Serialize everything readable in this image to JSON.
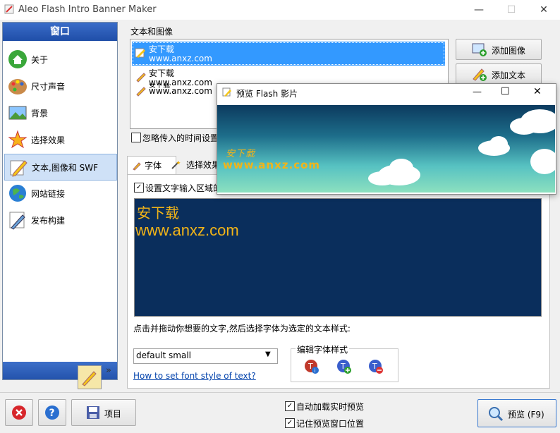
{
  "window": {
    "title": "Aleo Flash Intro Banner Maker",
    "minimize": "—",
    "maximize": "☐",
    "close": "✕"
  },
  "sidebar": {
    "header": "窗口",
    "items": [
      {
        "label": "关于",
        "icon": "home-icon"
      },
      {
        "label": "尺寸声音",
        "icon": "palette-icon"
      },
      {
        "label": "背景",
        "icon": "background-image-icon"
      },
      {
        "label": "选择效果",
        "icon": "effects-icon"
      },
      {
        "label": "文本,图像和 SWF",
        "icon": "pencil-icon",
        "selected": true
      },
      {
        "label": "网站链接",
        "icon": "globe-icon"
      },
      {
        "label": "发布构建",
        "icon": "publish-icon"
      }
    ],
    "more": "»"
  },
  "text_images": {
    "group_label": "文本和图像",
    "items": [
      {
        "line1": "安下载",
        "line2": "www.anxz.com",
        "selected": true
      },
      {
        "line1": "安下载",
        "line2": "www.anxz.com",
        "selected": false
      },
      {
        "line1": "安下载",
        "line2": "www.anxz.com",
        "selected": false
      }
    ],
    "add_image": "添加图像",
    "add_text": "添加文本",
    "ignore_time_label": "忽略传入的时间设置"
  },
  "tabs": [
    {
      "label": "字体",
      "active": true
    },
    {
      "label": "选择效果",
      "active": false
    }
  ],
  "font_tab": {
    "set_area_label": "设置文字输入区域的",
    "editor_line1": "安下载",
    "editor_line2": "www.anxz.com",
    "hint": "点击并拖动你想要的文字,然后选择字体为选定的文本样式:",
    "style_select": "default small",
    "help_link": "How to set font style of text?",
    "edit_style_group": "编辑字体样式"
  },
  "bottom": {
    "project_button": "项目",
    "auto_preview": "自动加载实时预览",
    "remember_position": "记住预览窗口位置",
    "preview_button": "预览 (F9)"
  },
  "preview_window": {
    "title": "预览 Flash 影片",
    "canvas_text": "www.anxz.com",
    "min": "—",
    "max": "☐",
    "close": "✕"
  },
  "colors": {
    "accent": "#1f4ea8",
    "editor_bg": "#0a2e5c",
    "text_gold": "#f2b418",
    "selection": "#3399ff"
  }
}
